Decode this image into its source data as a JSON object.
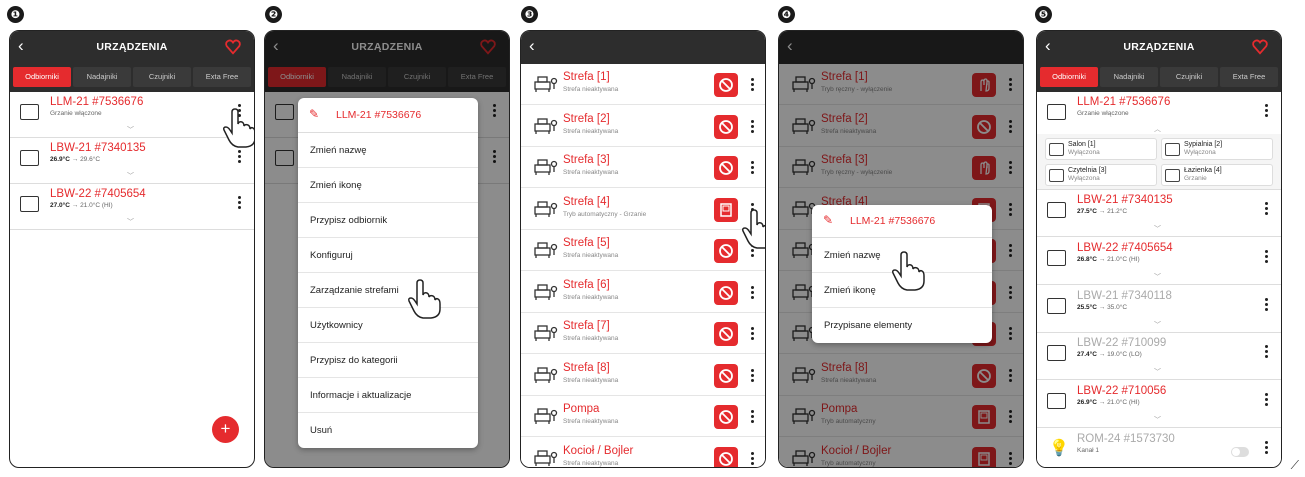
{
  "steps": [
    "❶",
    "❷",
    "❸",
    "❹",
    "❺"
  ],
  "colors": {
    "accent": "#e52b2e",
    "header": "#2d2d2d"
  },
  "header": {
    "title": "URZĄDZENIA",
    "back_icon": "chevron-left-icon",
    "right_icon": "heart-signal-icon"
  },
  "tabs": [
    "Odbiorniki",
    "Nadajniki",
    "Czujniki",
    "Exta Free"
  ],
  "screen1": {
    "devices": [
      {
        "name": "LLM-21 #7536676",
        "status": "Grzanie włączone"
      },
      {
        "name": "LBW-21 #7340135",
        "temp": "26.9°C",
        "target": "→ 29.6°C"
      },
      {
        "name": "LBW-22 #7405654",
        "temp": "27.0°C",
        "target": "→ 21.0°C (HI)"
      }
    ],
    "fab": "+"
  },
  "screen2": {
    "menu_title": "LLM-21 #7536676",
    "items": [
      "Zmień nazwę",
      "Zmień ikonę",
      "Przypisz odbiornik",
      "Konfiguruj",
      "Zarządzanie strefami",
      "Użytkownicy",
      "Przypisz do kategorii",
      "Informacje i aktualizacje",
      "Usuń"
    ]
  },
  "screen3": {
    "zones": [
      {
        "name": "Strefa [1]",
        "status": "Strefa nieaktywana",
        "btn": "blocked"
      },
      {
        "name": "Strefa [2]",
        "status": "Strefa nieaktywana",
        "btn": "blocked"
      },
      {
        "name": "Strefa [3]",
        "status": "Strefa nieaktywana",
        "btn": "blocked"
      },
      {
        "name": "Strefa [4]",
        "status": "Tryb automatyczny - Grzanie",
        "btn": "auto"
      },
      {
        "name": "Strefa [5]",
        "status": "Strefa nieaktywana",
        "btn": "blocked"
      },
      {
        "name": "Strefa [6]",
        "status": "Strefa nieaktywana",
        "btn": "blocked"
      },
      {
        "name": "Strefa [7]",
        "status": "Strefa nieaktywana",
        "btn": "blocked"
      },
      {
        "name": "Strefa [8]",
        "status": "Strefa nieaktywana",
        "btn": "blocked"
      },
      {
        "name": "Pompa",
        "status": "Strefa nieaktywana",
        "btn": "blocked"
      },
      {
        "name": "Kocioł / Bojler",
        "status": "Strefa nieaktywana",
        "btn": "blocked"
      }
    ]
  },
  "screen4": {
    "zones": [
      {
        "name": "Strefa [1]",
        "status": "Tryb ręczny - wyłączenie",
        "btn": "manual"
      },
      {
        "name": "Strefa [2]",
        "status": "Strefa nieaktywana",
        "btn": "blocked"
      },
      {
        "name": "Strefa [3]",
        "status": "Tryb ręczny - wyłączenie",
        "btn": "manual"
      },
      {
        "name": "Strefa [4]",
        "status": "",
        "btn": "auto"
      },
      {
        "name": "",
        "status": "",
        "btn": "blocked"
      },
      {
        "name": "",
        "status": "",
        "btn": "blocked"
      },
      {
        "name": "",
        "status": "Strefa nieaktywana",
        "btn": "blocked"
      },
      {
        "name": "Strefa [8]",
        "status": "Strefa nieaktywana",
        "btn": "blocked"
      },
      {
        "name": "Pompa",
        "status": "Tryb automatyczny",
        "btn": "auto"
      },
      {
        "name": "Kocioł / Bojler",
        "status": "Tryb automatyczny",
        "btn": "auto"
      }
    ],
    "menu_title": "LLM-21 #7536676",
    "items": [
      "Zmień nazwę",
      "Zmień ikonę",
      "Przypisane elementy"
    ]
  },
  "screen5": {
    "first": {
      "name": "LLM-21 #7536676",
      "status": "Grzanie włączone"
    },
    "rooms": [
      {
        "name": "Salon [1]",
        "status": "Wyłączona"
      },
      {
        "name": "Sypialnia [2]",
        "status": "Wyłączona"
      },
      {
        "name": "Czytelnia [3]",
        "status": "Wyłączona"
      },
      {
        "name": "Łazienka  [4]",
        "status": "Grzanie"
      }
    ],
    "devices": [
      {
        "name": "LBW-21 #7340135",
        "temp": "27.5°C",
        "target": "→ 21.2°C",
        "grey": false
      },
      {
        "name": "LBW-22 #7405654",
        "temp": "26.8°C",
        "target": "→ 21.0°C (HI)",
        "grey": false
      },
      {
        "name": "LBW-21 #7340118",
        "temp": "25.5°C",
        "target": "→ 35.0°C",
        "grey": true
      },
      {
        "name": "LBW-22 #710099",
        "temp": "27.4°C",
        "target": "→ 19.0°C (LO)",
        "grey": true
      },
      {
        "name": "LBW-22 #710056",
        "temp": "26.9°C",
        "target": "→ 21.0°C (HI)",
        "grey": false
      }
    ],
    "last": {
      "name": "ROM-24 #1573730",
      "status": "Kanał 1"
    }
  }
}
